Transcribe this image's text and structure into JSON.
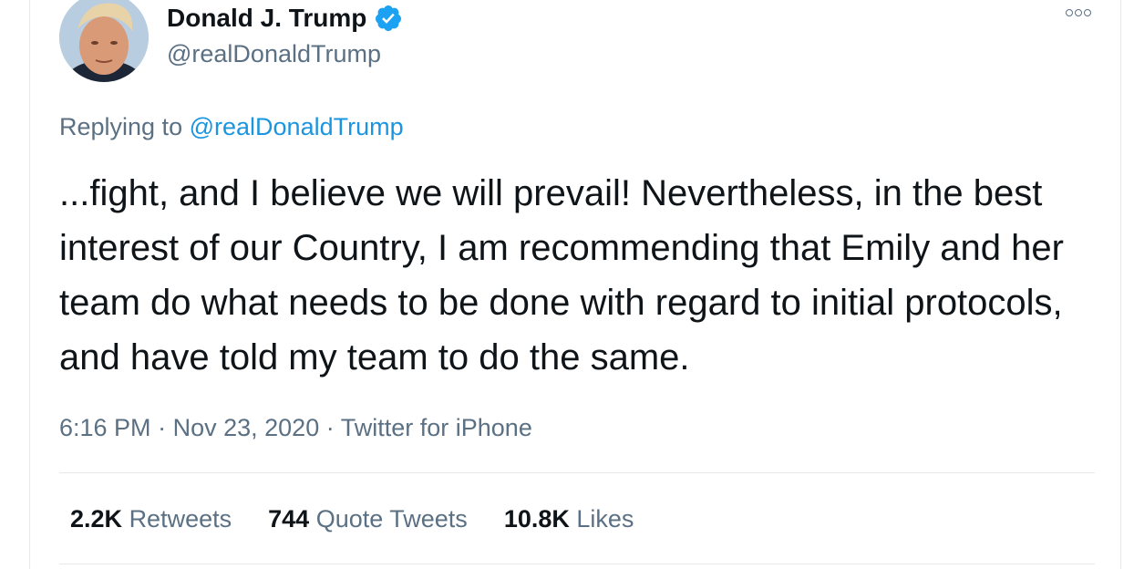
{
  "user": {
    "display_name": "Donald J. Trump",
    "handle": "@realDonaldTrump",
    "verified_icon": "verified-badge-icon"
  },
  "more_icon": "more-options-icon",
  "reply": {
    "prefix": "Replying to",
    "handle": "@realDonaldTrump"
  },
  "tweet": {
    "text": "...fight, and I believe we will prevail! Nevertheless, in the best interest of our Country, I am recommending that Emily and her team do what needs to be done with regard to initial protocols, and have told my team to do the same."
  },
  "meta": {
    "time": "6:16 PM",
    "sep1": "·",
    "date": "Nov 23, 2020",
    "sep2": "·",
    "source": "Twitter for iPhone"
  },
  "stats": {
    "retweets_count": "2.2K",
    "retweets_label": "Retweets",
    "quotes_count": "744",
    "quotes_label": "Quote Tweets",
    "likes_count": "10.8K",
    "likes_label": "Likes"
  },
  "colors": {
    "link": "#1b95e0",
    "secondary": "#5b7083",
    "verified": "#1da1f2",
    "divider": "#e6e9ec"
  }
}
